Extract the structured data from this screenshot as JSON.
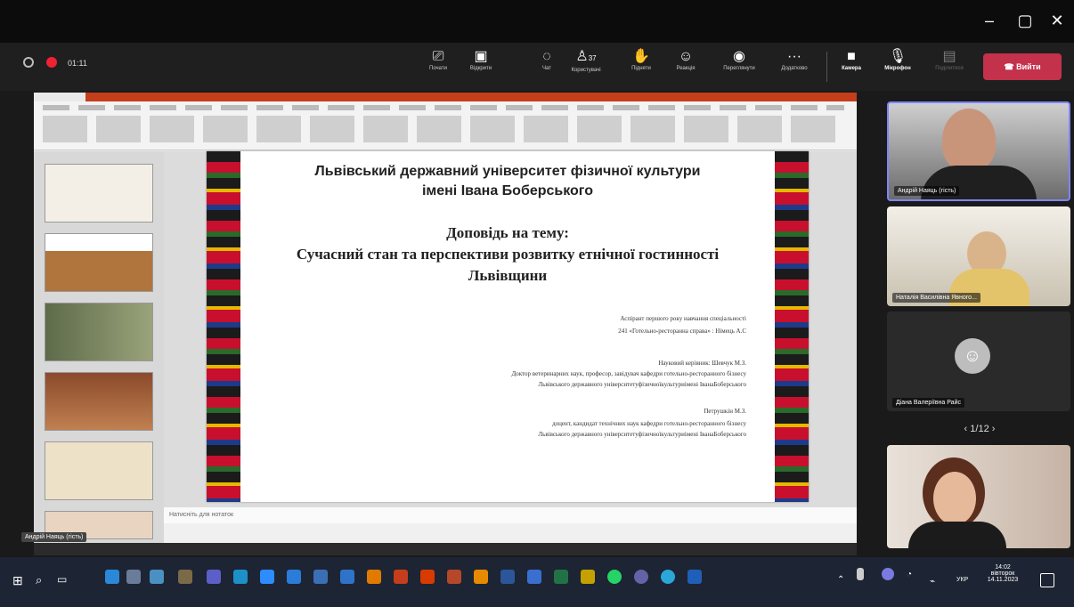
{
  "meeting": {
    "timer": "01:11",
    "toolbar": [
      {
        "icon": "share-screen-icon",
        "label": "Почати"
      },
      {
        "icon": "document-icon",
        "label": "Відкрити"
      },
      {
        "icon": "chat-icon",
        "label": "Чат"
      },
      {
        "icon": "people-icon",
        "label": "Користувачі",
        "count": "37"
      },
      {
        "icon": "raise-hand-icon",
        "label": "Підняти"
      },
      {
        "icon": "reactions-icon",
        "label": "Реакція"
      },
      {
        "icon": "rooms-icon",
        "label": "Переглянути"
      },
      {
        "icon": "more-icon",
        "label": "Додатково"
      },
      {
        "icon": "camera-icon",
        "label": "Камера"
      },
      {
        "icon": "mic-off-icon",
        "label": "Мікрофон"
      },
      {
        "icon": "share-icon",
        "label": "Поділитися"
      }
    ],
    "leave_label": "Вийти",
    "pager": "1/12",
    "presenter_badge": "Андрій Наяць (гість)"
  },
  "participants": [
    {
      "name": "Андрій Наяць (гість)",
      "type": "video"
    },
    {
      "name": "Наталія Василівна Явного...",
      "type": "video"
    },
    {
      "name": "Діана Валеріївна Райс",
      "type": "avatar"
    },
    {
      "name": "",
      "type": "video"
    }
  ],
  "slide": {
    "university_line1": "Львівський державний університет фізичної культури",
    "university_line2": "імені Івана Боберського",
    "report_label": "Доповідь на тему:",
    "topic_line1": "Сучасний стан та перспективи розвитку етнічної гостинності",
    "topic_line2": "Львівщини",
    "author_line1": "Аспірант першого року навчання спеціальності",
    "author_line2": "241 «Готельно-ресторанна справа» : Німець А.С",
    "supervisor_line1": "Науковий керівник: Шевчук М.З.",
    "supervisor_line2": "Доктор ветеринарних наук, професор, завідувач кафедри готельно-ресторанного бізнесу",
    "supervisor_line3": "Львівського державного університетуфізичноїкультуриімені ІванаБоберського",
    "reviewer_line1": "Петрушкін М.З.",
    "reviewer_line2": "доцент, кандидат технічних наук кафедри готельно-ресторанного бізнесу",
    "reviewer_line3": "Львівського державного університетуфізичноїкультуриімені ІванаБоберського"
  },
  "ppt": {
    "notes_placeholder": "Натисніть для нотаток"
  },
  "taskbar": {
    "lang": "УКР",
    "time": "14:02",
    "weekday": "вівторок",
    "date": "14.11.2023"
  },
  "colors": {
    "leave": "#c4314b",
    "titlebar": "#0c0c0c",
    "toolbar": "#1f1f1f",
    "taskbar": "#1d2433"
  }
}
